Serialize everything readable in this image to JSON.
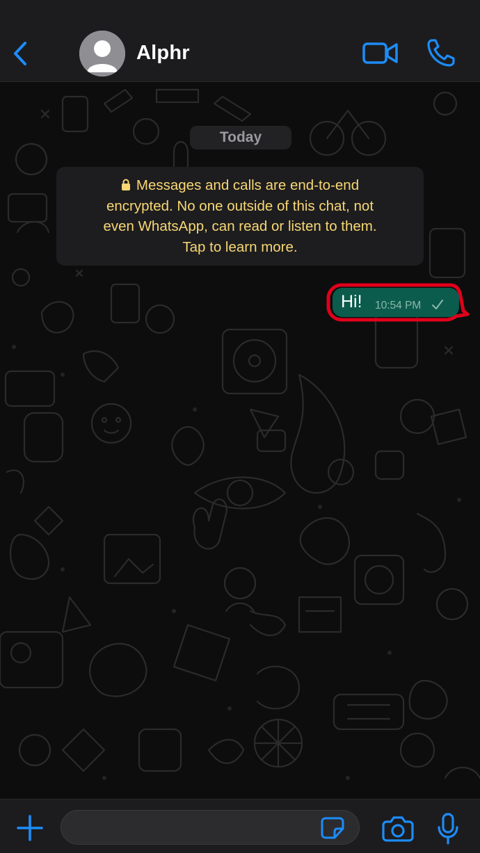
{
  "header": {
    "contact_name": "Alphr",
    "icons": {
      "back": "chevron-left-icon",
      "avatar": "person-avatar-icon",
      "video": "video-camera-icon",
      "call": "phone-icon"
    }
  },
  "chat": {
    "date_label": "Today",
    "encryption_notice": {
      "icon": "lock-icon",
      "lines": [
        "Messages and calls are end-to-end",
        "encrypted. No one outside of this chat, not",
        "even WhatsApp, can read or listen to them.",
        "Tap to learn more."
      ]
    },
    "messages": [
      {
        "direction": "outgoing",
        "text": "Hi!",
        "time": "10:54 PM",
        "status_icon": "single-check-icon",
        "highlighted": true
      }
    ]
  },
  "input_bar": {
    "placeholder": "",
    "icons": {
      "attach": "plus-icon",
      "sticker": "sticker-icon",
      "camera": "camera-icon",
      "mic": "microphone-icon"
    }
  },
  "colors": {
    "accent": "#1d8cf8",
    "header_bg": "#1c1c1e",
    "chat_bg": "#0d0d0d",
    "outgoing_bubble": "#0b5c4c",
    "encryption_text": "#f7d774",
    "highlight_outline": "#e0001b"
  }
}
